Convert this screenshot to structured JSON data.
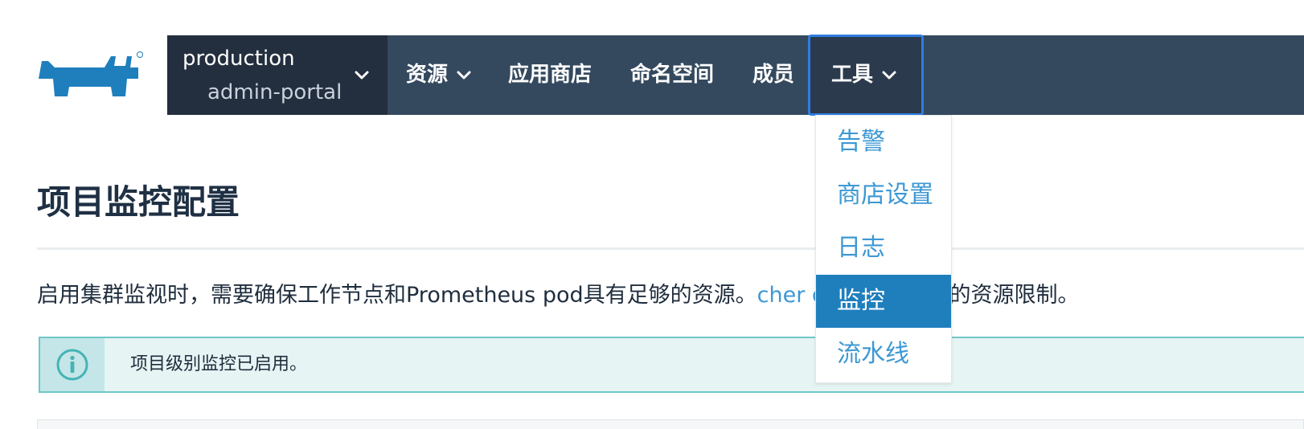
{
  "scope": {
    "cluster": "production",
    "project": "admin-portal"
  },
  "nav": {
    "resources": "资源",
    "catalog": "应用商店",
    "namespaces": "命名空间",
    "members": "成员",
    "tools": "工具"
  },
  "tools_menu": {
    "items": [
      "告警",
      "商店设置",
      "日志",
      "监控",
      "流水线"
    ],
    "selected": "监控"
  },
  "page": {
    "title": "项目监控配置",
    "desc_before": "启用集群监视时，需要确保工作节点和Prometheus pod具有足够的资源。",
    "desc_link": "cher docs",
    "desc_after": "了解建议的资源限制。"
  },
  "alert": {
    "icon": "info-icon",
    "message": "项目级别监控已启用。"
  },
  "colors": {
    "navbar": "#34495e",
    "scope_bg": "#232f3e",
    "link": "#3d98d3",
    "selected_item": "#1f7fbd",
    "alert_bg": "#e6f4f4",
    "alert_border": "#6fc7c7"
  },
  "icons": {
    "logo": "rancher-cow-logo",
    "dropdown": "chevron-down-icon"
  }
}
